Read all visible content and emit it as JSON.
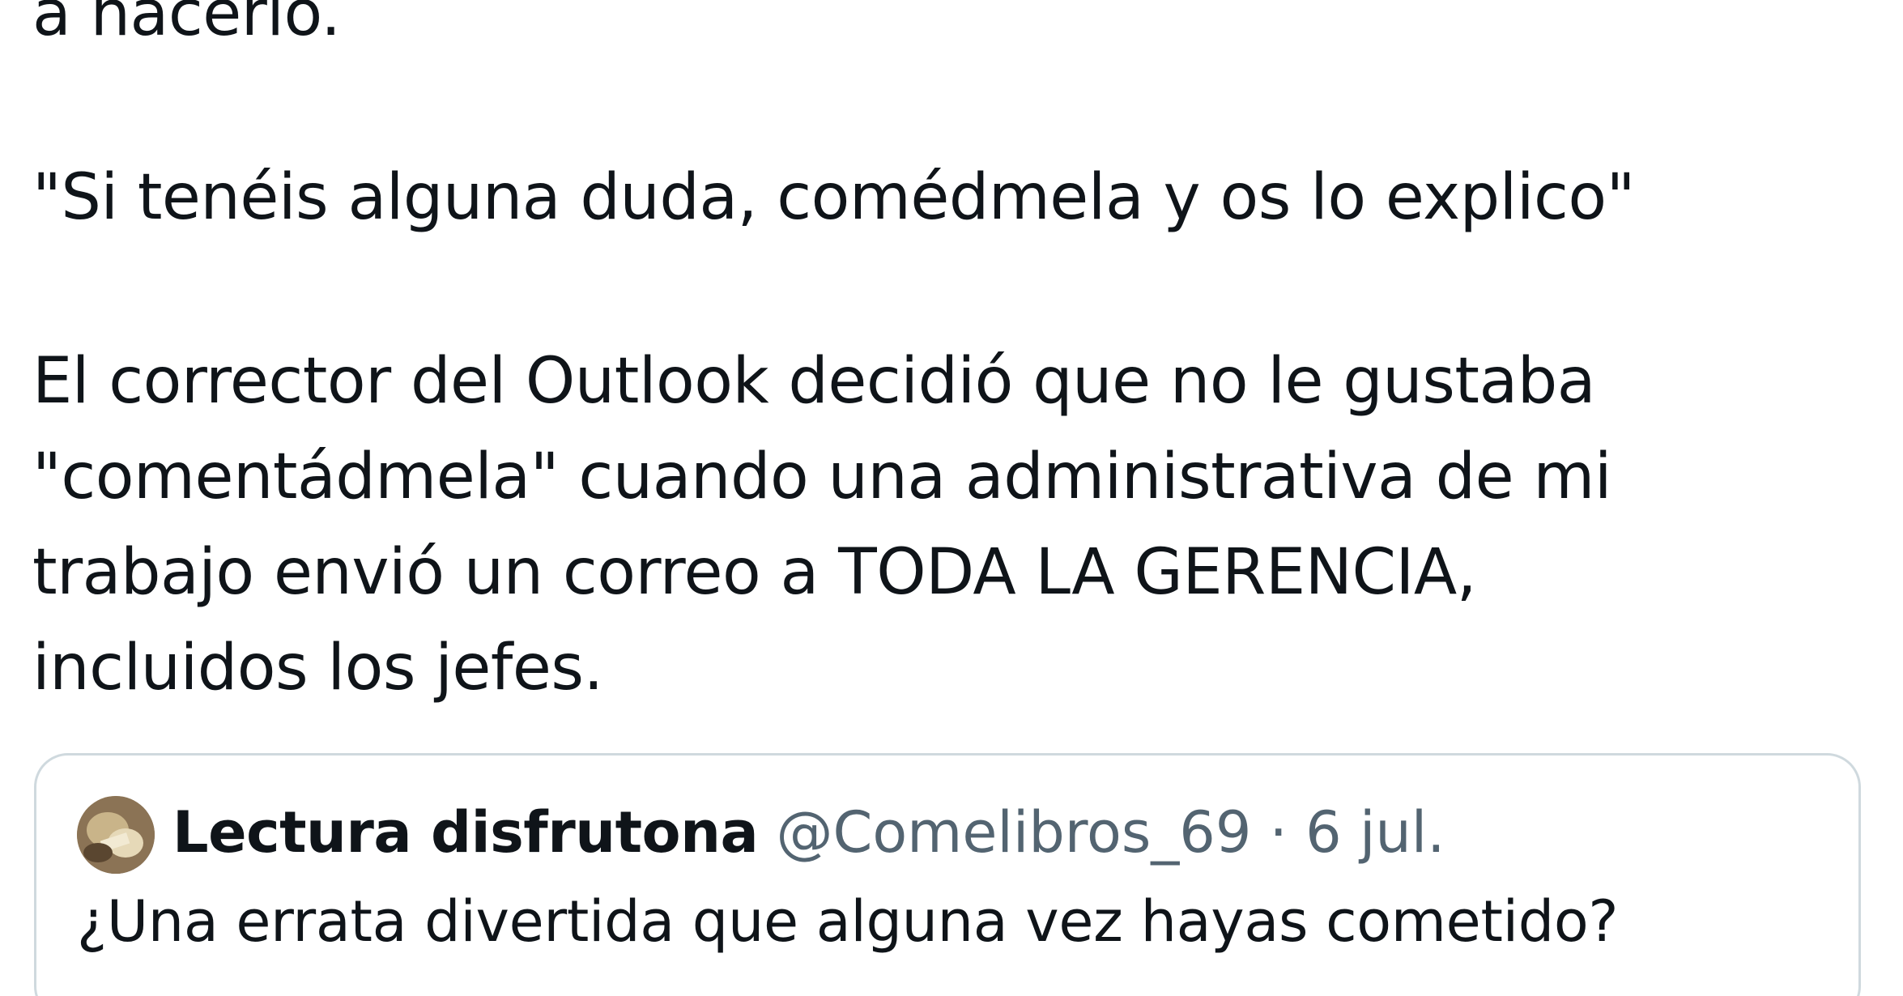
{
  "tweet": {
    "lines": [
      "a hacerlo.",
      "\"Si tenéis alguna duda, comédmela y os lo explico\"",
      "El corrector del Outlook decidió que no le gustaba",
      "\"comentádmela\" cuando una administrativa de mi",
      "trabajo envió un correo a TODA LA GERENCIA,",
      "incluidos los jefes."
    ]
  },
  "quoted_tweet": {
    "author_name": "Lectura disfrutona",
    "handle": "@Comelibros_69",
    "separator": "·",
    "date": "6 jul.",
    "text": "¿Una errata divertida que alguna vez hayas cometido?"
  },
  "colors": {
    "text": "#0f1419",
    "secondary_text": "#536471",
    "border": "#cfd9de"
  }
}
